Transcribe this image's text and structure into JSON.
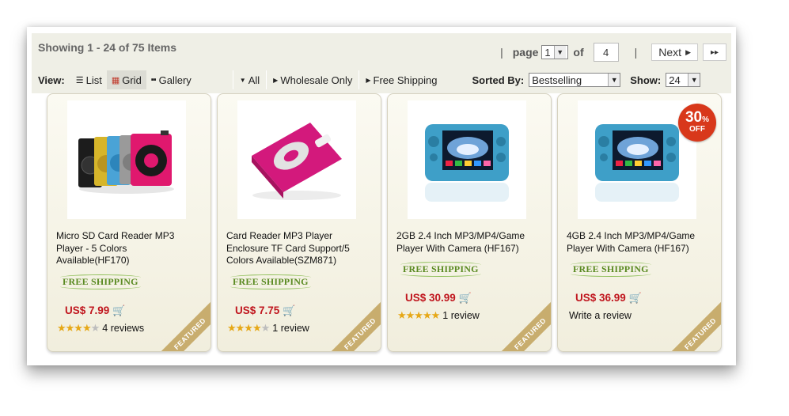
{
  "header": {
    "showing": "Showing 1 - 24 of 75 Items",
    "page_label": "page",
    "page_value": "1",
    "of_label": "of",
    "total_pages": "4",
    "next_label": "Next",
    "last_label": "▸▸"
  },
  "view": {
    "label": "View:",
    "options": [
      {
        "label": "List",
        "icon": "list-icon"
      },
      {
        "label": "Grid",
        "icon": "grid-icon",
        "active": true
      },
      {
        "label": "Gallery",
        "icon": "gallery-icon"
      }
    ],
    "filters": [
      "All",
      "Wholesale Only",
      "Free Shipping"
    ],
    "sorted_label": "Sorted By:",
    "sorted_value": "Bestselling",
    "show_label": "Show:",
    "show_value": "24"
  },
  "products": [
    {
      "title": "Micro SD Card Reader MP3 Player - 5 Colors Available(HF170)",
      "free_shipping": "FREE SHIPPING",
      "price": "US$ 7.99",
      "stars": 4,
      "reviews": "4 reviews",
      "ribbon": "FEATURED"
    },
    {
      "title": "Card Reader MP3 Player Enclosure TF Card Support/5 Colors Available(SZM871)",
      "free_shipping": "FREE SHIPPING",
      "price": "US$ 7.75",
      "stars": 4,
      "reviews": "1 review",
      "ribbon": "FEATURED"
    },
    {
      "title": "2GB 2.4 Inch MP3/MP4/Game Player With Camera (HF167)",
      "free_shipping": "FREE SHIPPING",
      "price": "US$ 30.99",
      "stars": 5,
      "reviews": "1 review",
      "ribbon": "FEATURED"
    },
    {
      "title": "4GB 2.4 Inch MP3/MP4/Game Player With Camera (HF167)",
      "free_shipping": "FREE SHIPPING",
      "price": "US$ 36.99",
      "write_review": "Write a review",
      "ribbon": "FEATURED",
      "badge_pct": "30",
      "badge_pct_sign": "%",
      "badge_off": "OFF"
    }
  ],
  "colors": {
    "price": "#c0161e",
    "free_shipping": "#5a8a22",
    "badge": "#d8381b",
    "ribbon": "#c8ad6e",
    "toolbar": "#efefe6"
  }
}
